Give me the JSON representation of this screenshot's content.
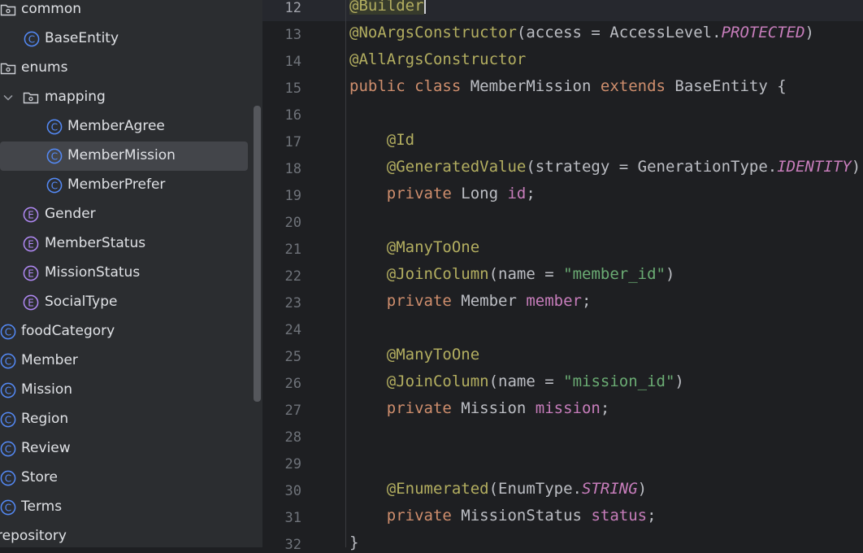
{
  "project_tree": {
    "items": [
      {
        "label": "common",
        "kind": "package",
        "icon": "package-folder-icon",
        "expanded": false
      },
      {
        "label": "BaseEntity",
        "kind": "class",
        "icon": "class-icon"
      },
      {
        "label": "enums",
        "kind": "package",
        "icon": "package-folder-icon",
        "expanded": false
      },
      {
        "label": "mapping",
        "kind": "package",
        "icon": "package-folder-icon",
        "expanded": true
      },
      {
        "label": "MemberAgree",
        "kind": "class",
        "icon": "class-icon"
      },
      {
        "label": "MemberMission",
        "kind": "class",
        "icon": "class-icon",
        "selected": true
      },
      {
        "label": "MemberPrefer",
        "kind": "class",
        "icon": "class-icon"
      },
      {
        "label": "Gender",
        "kind": "enum",
        "icon": "enum-icon"
      },
      {
        "label": "MemberStatus",
        "kind": "enum",
        "icon": "enum-icon"
      },
      {
        "label": "MissionStatus",
        "kind": "enum",
        "icon": "enum-icon"
      },
      {
        "label": "SocialType",
        "kind": "enum",
        "icon": "enum-icon"
      },
      {
        "label": "foodCategory",
        "kind": "class",
        "icon": "class-icon"
      },
      {
        "label": "Member",
        "kind": "class",
        "icon": "class-icon"
      },
      {
        "label": "Mission",
        "kind": "class",
        "icon": "class-icon"
      },
      {
        "label": "Region",
        "kind": "class",
        "icon": "class-icon"
      },
      {
        "label": "Review",
        "kind": "class",
        "icon": "class-icon"
      },
      {
        "label": "Store",
        "kind": "class",
        "icon": "class-icon"
      },
      {
        "label": "Terms",
        "kind": "class",
        "icon": "class-icon"
      },
      {
        "label": "repository",
        "kind": "package",
        "icon": "package-folder-icon"
      }
    ]
  },
  "editor": {
    "current_line": 12,
    "lines": [
      {
        "num": "12",
        "tokens": [
          {
            "t": "@Builder",
            "c": "ann ann-hl"
          }
        ],
        "caret": true
      },
      {
        "num": "13",
        "tokens": [
          {
            "t": "@NoArgsConstructor",
            "c": "ann"
          },
          {
            "t": "(access = AccessLevel.",
            "c": ""
          },
          {
            "t": "PROTECTED",
            "c": "const"
          },
          {
            "t": ")",
            "c": ""
          }
        ]
      },
      {
        "num": "14",
        "tokens": [
          {
            "t": "@AllArgsConstructor",
            "c": "ann"
          }
        ]
      },
      {
        "num": "15",
        "tokens": [
          {
            "t": "public class ",
            "c": "kw"
          },
          {
            "t": "MemberMission ",
            "c": ""
          },
          {
            "t": "extends ",
            "c": "kw"
          },
          {
            "t": "BaseEntity {",
            "c": ""
          }
        ]
      },
      {
        "num": "16",
        "tokens": []
      },
      {
        "num": "17",
        "tokens": [
          {
            "t": "    ",
            "c": ""
          },
          {
            "t": "@Id",
            "c": "ann"
          }
        ]
      },
      {
        "num": "18",
        "tokens": [
          {
            "t": "    ",
            "c": ""
          },
          {
            "t": "@GeneratedValue",
            "c": "ann"
          },
          {
            "t": "(strategy = GenerationType.",
            "c": ""
          },
          {
            "t": "IDENTITY",
            "c": "const"
          },
          {
            "t": ")",
            "c": ""
          }
        ]
      },
      {
        "num": "19",
        "tokens": [
          {
            "t": "    ",
            "c": ""
          },
          {
            "t": "private ",
            "c": "kw"
          },
          {
            "t": "Long ",
            "c": ""
          },
          {
            "t": "id",
            "c": "fld"
          },
          {
            "t": ";",
            "c": ""
          }
        ]
      },
      {
        "num": "20",
        "tokens": []
      },
      {
        "num": "21",
        "tokens": [
          {
            "t": "    ",
            "c": ""
          },
          {
            "t": "@ManyToOne",
            "c": "ann"
          }
        ]
      },
      {
        "num": "22",
        "tokens": [
          {
            "t": "    ",
            "c": ""
          },
          {
            "t": "@JoinColumn",
            "c": "ann"
          },
          {
            "t": "(name = ",
            "c": ""
          },
          {
            "t": "\"member_id\"",
            "c": "str"
          },
          {
            "t": ")",
            "c": ""
          }
        ]
      },
      {
        "num": "23",
        "tokens": [
          {
            "t": "    ",
            "c": ""
          },
          {
            "t": "private ",
            "c": "kw"
          },
          {
            "t": "Member ",
            "c": ""
          },
          {
            "t": "member",
            "c": "fld"
          },
          {
            "t": ";",
            "c": ""
          }
        ]
      },
      {
        "num": "24",
        "tokens": []
      },
      {
        "num": "25",
        "tokens": [
          {
            "t": "    ",
            "c": ""
          },
          {
            "t": "@ManyToOne",
            "c": "ann"
          }
        ]
      },
      {
        "num": "26",
        "tokens": [
          {
            "t": "    ",
            "c": ""
          },
          {
            "t": "@JoinColumn",
            "c": "ann"
          },
          {
            "t": "(name = ",
            "c": ""
          },
          {
            "t": "\"mission_id\"",
            "c": "str"
          },
          {
            "t": ")",
            "c": ""
          }
        ]
      },
      {
        "num": "27",
        "tokens": [
          {
            "t": "    ",
            "c": ""
          },
          {
            "t": "private ",
            "c": "kw"
          },
          {
            "t": "Mission ",
            "c": ""
          },
          {
            "t": "mission",
            "c": "fld"
          },
          {
            "t": ";",
            "c": ""
          }
        ]
      },
      {
        "num": "28",
        "tokens": []
      },
      {
        "num": "29",
        "tokens": []
      },
      {
        "num": "30",
        "tokens": [
          {
            "t": "    ",
            "c": ""
          },
          {
            "t": "@Enumerated",
            "c": "ann"
          },
          {
            "t": "(EnumType.",
            "c": ""
          },
          {
            "t": "STRING",
            "c": "const"
          },
          {
            "t": ")",
            "c": ""
          }
        ]
      },
      {
        "num": "31",
        "tokens": [
          {
            "t": "    ",
            "c": ""
          },
          {
            "t": "private ",
            "c": "kw"
          },
          {
            "t": "MissionStatus ",
            "c": ""
          },
          {
            "t": "status",
            "c": "fld"
          },
          {
            "t": ";",
            "c": ""
          }
        ]
      },
      {
        "num": "32",
        "tokens": [
          {
            "t": "}",
            "c": ""
          }
        ]
      }
    ]
  },
  "colors": {
    "background": "#1e1f22",
    "sidebar": "#2b2d30",
    "selection": "#43454a",
    "annotation": "#b3ae60",
    "keyword": "#cf8e6d",
    "field": "#c77dbb",
    "string": "#6aab73",
    "class_icon": "#548af7",
    "enum_icon": "#b189f5"
  }
}
